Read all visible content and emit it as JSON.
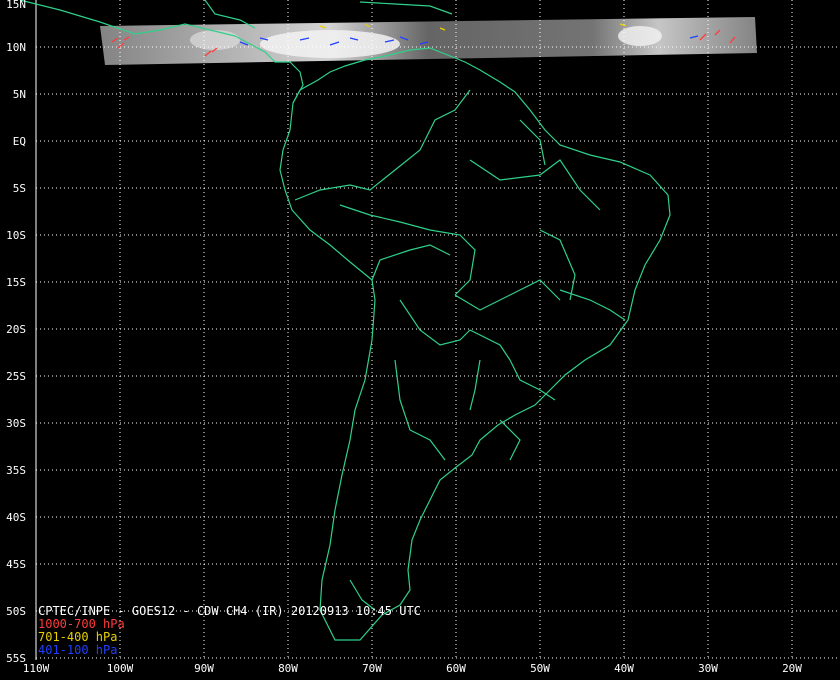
{
  "map": {
    "title": "CPTEC/INPE - GOES12 - CDW CH4 (IR) 20120913 10:45 UTC",
    "legend": [
      {
        "label": "1000-700 hPa",
        "color": "#ff3b3b"
      },
      {
        "label": "701-400 hPa",
        "color": "#e8d000"
      },
      {
        "label": "401-100 hPa",
        "color": "#2040ff"
      }
    ],
    "lat_labels": [
      "15N",
      "10N",
      "5N",
      "EQ",
      "5S",
      "10S",
      "15S",
      "20S",
      "25S",
      "30S",
      "35S",
      "40S",
      "45S",
      "50S",
      "55S"
    ],
    "lon_labels": [
      "110W",
      "100W",
      "90W",
      "80W",
      "70W",
      "60W",
      "50W",
      "40W",
      "30W",
      "20W"
    ],
    "colors": {
      "background": "#000000",
      "grid": "#ffffff",
      "coastline": "#2fd08a",
      "satellite_strip": "#888888"
    }
  }
}
